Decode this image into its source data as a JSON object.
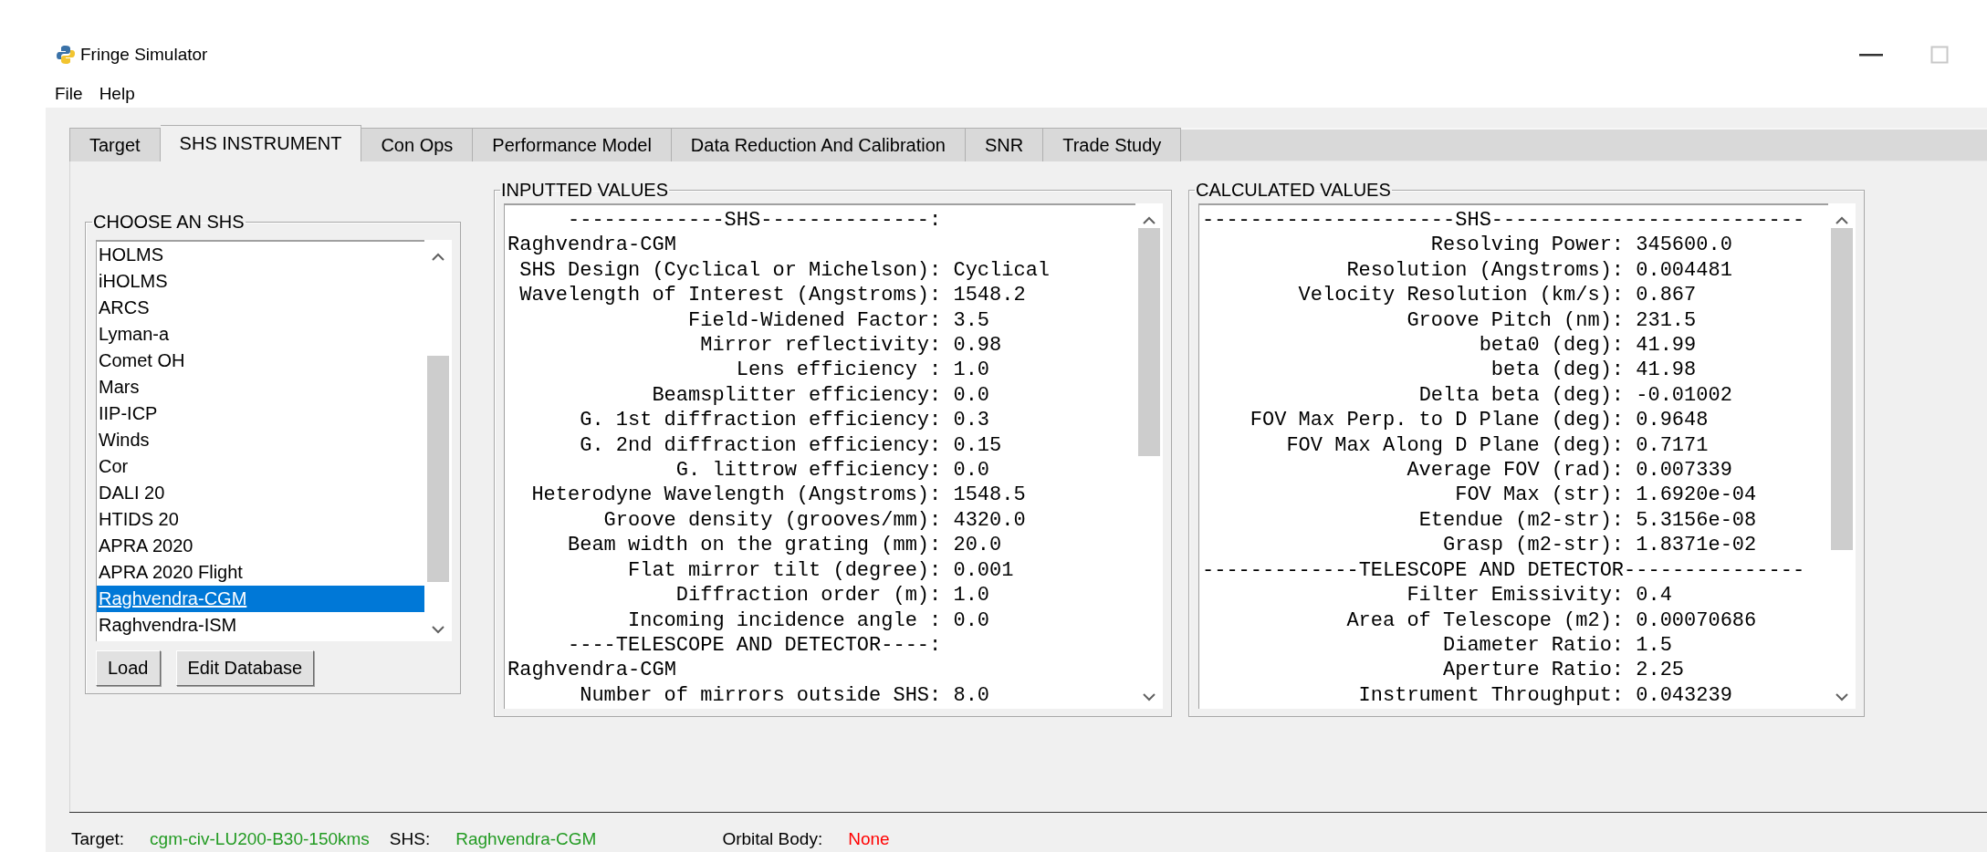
{
  "window": {
    "title": "Fringe Simulator"
  },
  "menu": [
    "File",
    "Help"
  ],
  "tabs": [
    {
      "label": "Target",
      "selected": false
    },
    {
      "label": "SHS INSTRUMENT",
      "selected": true
    },
    {
      "label": "Con Ops",
      "selected": false
    },
    {
      "label": "Performance Model",
      "selected": false
    },
    {
      "label": "Data Reduction And Calibration",
      "selected": false
    },
    {
      "label": "SNR",
      "selected": false
    },
    {
      "label": "Trade Study",
      "selected": false
    }
  ],
  "shs_chooser": {
    "title": "CHOOSE AN SHS",
    "items": [
      {
        "label": "HOLMS",
        "selected": false
      },
      {
        "label": "iHOLMS",
        "selected": false
      },
      {
        "label": "ARCS",
        "selected": false
      },
      {
        "label": "Lyman-a",
        "selected": false
      },
      {
        "label": "Comet OH",
        "selected": false
      },
      {
        "label": "Mars",
        "selected": false
      },
      {
        "label": "IIP-ICP",
        "selected": false
      },
      {
        "label": "Winds",
        "selected": false
      },
      {
        "label": "Cor",
        "selected": false
      },
      {
        "label": "DALI 20",
        "selected": false
      },
      {
        "label": "HTIDS 20",
        "selected": false
      },
      {
        "label": "APRA 2020",
        "selected": false
      },
      {
        "label": "APRA 2020 Flight",
        "selected": false
      },
      {
        "label": "Raghvendra-CGM",
        "selected": true
      },
      {
        "label": "Raghvendra-ISM",
        "selected": false
      }
    ],
    "buttons": [
      "Load",
      "Edit Database"
    ]
  },
  "inputted_values": {
    "title": "INPUTTED VALUES",
    "lines": [
      {
        "kind": "header",
        "text": "-------------SHS--------------:"
      },
      {
        "kind": "name",
        "text": "Raghvendra-CGM"
      },
      {
        "kind": "field",
        "label": "SHS Design (Cyclical or Michelson):",
        "value": "Cyclical"
      },
      {
        "kind": "field",
        "label": "Wavelength of Interest (Angstroms):",
        "value": "1548.2"
      },
      {
        "kind": "field",
        "label": "Field-Widened Factor:",
        "value": "3.5"
      },
      {
        "kind": "field",
        "label": "Mirror reflectivity:",
        "value": "0.98"
      },
      {
        "kind": "field",
        "label": "Lens efficiency :",
        "value": "1.0"
      },
      {
        "kind": "field",
        "label": "Beamsplitter efficiency:",
        "value": "0.0"
      },
      {
        "kind": "field",
        "label": "G. 1st diffraction efficiency:",
        "value": "0.3"
      },
      {
        "kind": "field",
        "label": "G. 2nd diffraction efficiency:",
        "value": "0.15"
      },
      {
        "kind": "field",
        "label": "G. littrow efficiency:",
        "value": "0.0"
      },
      {
        "kind": "field",
        "label": "Heterodyne Wavelength (Angstroms):",
        "value": "1548.5"
      },
      {
        "kind": "field",
        "label": "Groove density (grooves/mm):",
        "value": "4320.0"
      },
      {
        "kind": "field",
        "label": "Beam width on the grating (mm):",
        "value": "20.0"
      },
      {
        "kind": "field",
        "label": "Flat mirror tilt (degree):",
        "value": "0.001"
      },
      {
        "kind": "field",
        "label": "Diffraction order (m):",
        "value": "1.0"
      },
      {
        "kind": "field",
        "label": "Incoming incidence angle :",
        "value": "0.0"
      },
      {
        "kind": "header",
        "text": "----TELESCOPE AND DETECTOR----:"
      },
      {
        "kind": "name",
        "text": "Raghvendra-CGM"
      },
      {
        "kind": "field",
        "label": "Number of mirrors outside SHS:",
        "value": "8.0"
      }
    ]
  },
  "calculated_values": {
    "title": "CALCULATED VALUES",
    "lines": [
      {
        "kind": "rule",
        "text": "---------------------SHS--------------------------"
      },
      {
        "kind": "field",
        "label": "Resolving Power:",
        "value": "345600.0"
      },
      {
        "kind": "field",
        "label": "Resolution (Angstroms):",
        "value": "0.004481"
      },
      {
        "kind": "field",
        "label": "Velocity Resolution (km/s):",
        "value": "0.867"
      },
      {
        "kind": "field",
        "label": "Groove Pitch (nm):",
        "value": "231.5"
      },
      {
        "kind": "field",
        "label": "beta0 (deg):",
        "value": "41.99"
      },
      {
        "kind": "field",
        "label": "beta (deg):",
        "value": "41.98"
      },
      {
        "kind": "field",
        "label": "Delta beta (deg):",
        "value": "-0.01002"
      },
      {
        "kind": "field",
        "label": "FOV Max Perp. to D Plane (deg):",
        "value": "0.9648"
      },
      {
        "kind": "field",
        "label": "FOV Max Along D Plane (deg):",
        "value": "0.7171"
      },
      {
        "kind": "field",
        "label": "Average FOV (rad):",
        "value": "0.007339"
      },
      {
        "kind": "field",
        "label": "FOV Max (str):",
        "value": "1.6920e-04"
      },
      {
        "kind": "field",
        "label": "Etendue (m2-str):",
        "value": "5.3156e-08"
      },
      {
        "kind": "field",
        "label": "Grasp (m2-str):",
        "value": "1.8371e-02"
      },
      {
        "kind": "rule",
        "text": "-------------TELESCOPE AND DETECTOR---------------"
      },
      {
        "kind": "field",
        "label": "Filter Emissivity:",
        "value": "0.4"
      },
      {
        "kind": "field",
        "label": "Area of Telescope (m2):",
        "value": "0.00070686"
      },
      {
        "kind": "field",
        "label": "Diameter Ratio:",
        "value": "1.5"
      },
      {
        "kind": "field",
        "label": "Aperture Ratio:",
        "value": "2.25"
      },
      {
        "kind": "field",
        "label": "Instrument Throughput:",
        "value": "0.043239"
      }
    ]
  },
  "status_bar": [
    {
      "label": "Target:",
      "value": "cgm-civ-LU200-B30-150kms",
      "color": "#239b23"
    },
    {
      "label": "SHS:",
      "value": "Raghvendra-CGM",
      "color": "#239b23"
    },
    {
      "label": "Orbital Body:",
      "value": "None",
      "color": "#ff0000"
    }
  ]
}
